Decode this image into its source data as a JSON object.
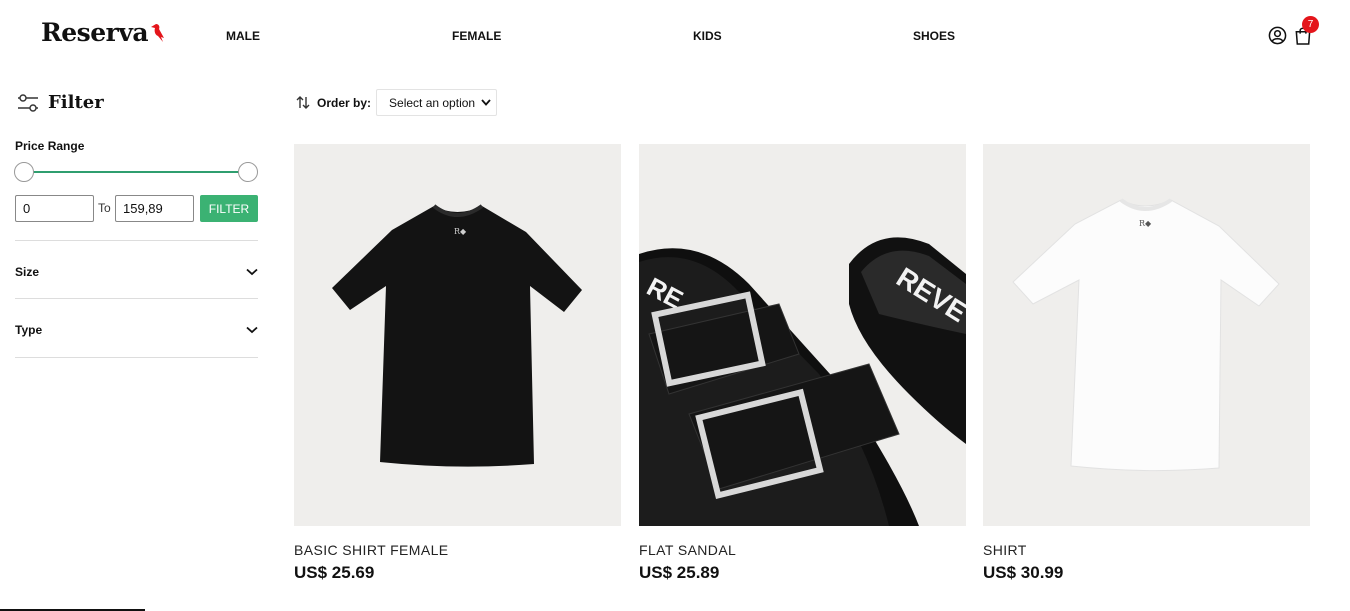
{
  "header": {
    "logo": "Reserva",
    "nav": [
      "MALE",
      "FEMALE",
      "KIDS",
      "SHOES"
    ],
    "cart_count": "7"
  },
  "sidebar": {
    "title": "Filter",
    "price_range_label": "Price Range",
    "price_min": "0",
    "price_to_label": "To",
    "price_max": "159,89",
    "filter_button": "FILTER",
    "sections": [
      "Size",
      "Type"
    ]
  },
  "toolbar": {
    "order_label": "Order by:",
    "order_selected": "Select an option"
  },
  "products": [
    {
      "name": "BASIC SHIRT FEMALE",
      "price": "US$ 25.69"
    },
    {
      "name": "FLAT SANDAL",
      "price": "US$ 25.89"
    },
    {
      "name": "SHIRT",
      "price": "US$ 30.99"
    }
  ],
  "colors": {
    "accent_green": "#3bb273",
    "badge_red": "#e4151b"
  }
}
